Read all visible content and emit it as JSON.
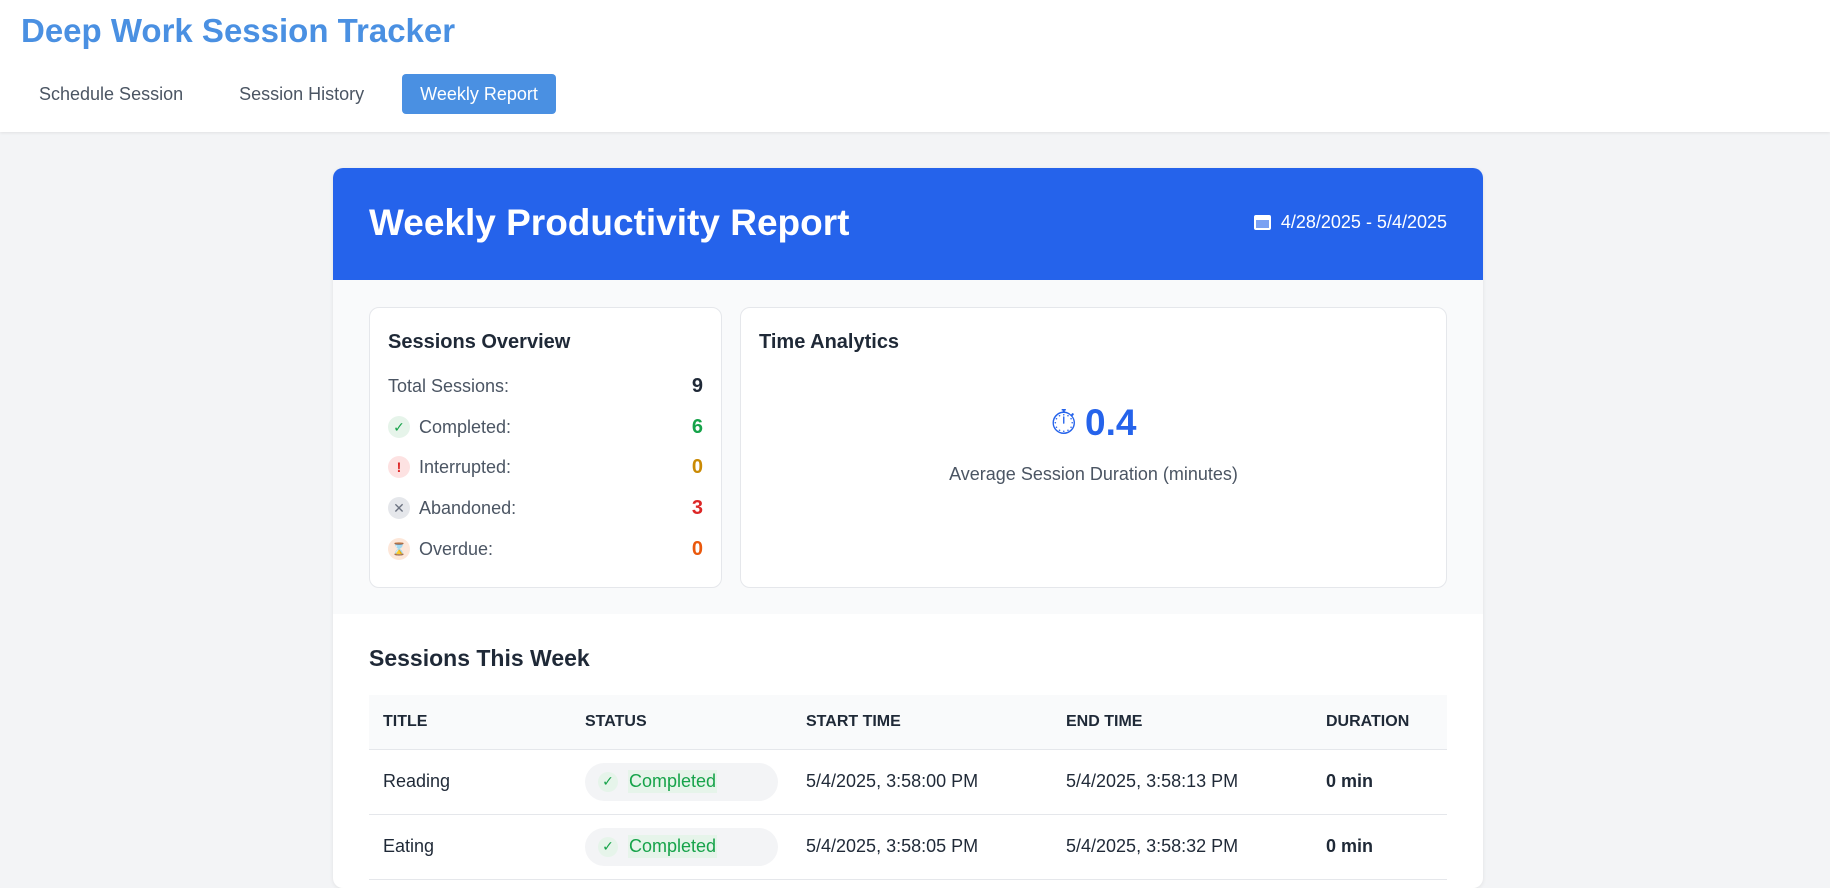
{
  "app": {
    "title": "Deep Work Session Tracker"
  },
  "nav": {
    "tabs": [
      {
        "label": "Schedule Session"
      },
      {
        "label": "Session History"
      },
      {
        "label": "Weekly Report",
        "active": true
      }
    ]
  },
  "report": {
    "title": "Weekly Productivity Report",
    "date_range": "4/28/2025 - 5/4/2025",
    "date_icon": "calendar-icon"
  },
  "overview": {
    "title": "Sessions Overview",
    "total_label": "Total Sessions:",
    "total_value": "9",
    "completed_label": "Completed:",
    "completed_value": "6",
    "interrupted_label": "Interrupted:",
    "interrupted_value": "0",
    "abandoned_label": "Abandoned:",
    "abandoned_value": "3",
    "overdue_label": "Overdue:",
    "overdue_value": "0",
    "colors": {
      "completed": "#16a34a",
      "interrupted": "#ca8a04",
      "abandoned": "#dc2626",
      "overdue": "#ea580c"
    }
  },
  "time_analytics": {
    "title": "Time Analytics",
    "icon": "stopwatch-icon",
    "value": "0.4",
    "label": "Average Session Duration (minutes)"
  },
  "sessions": {
    "title": "Sessions This Week",
    "columns": [
      "TITLE",
      "STATUS",
      "START TIME",
      "END TIME",
      "DURATION"
    ],
    "rows": [
      {
        "title": "Reading",
        "status": "Completed",
        "start": "5/4/2025, 3:58:00 PM",
        "end": "5/4/2025, 3:58:13 PM",
        "duration": "0 min"
      },
      {
        "title": "Eating",
        "status": "Completed",
        "start": "5/4/2025, 3:58:05 PM",
        "end": "5/4/2025, 3:58:32 PM",
        "duration": "0 min"
      }
    ]
  },
  "accent": "#2563eb",
  "brand": "#4a90e2"
}
